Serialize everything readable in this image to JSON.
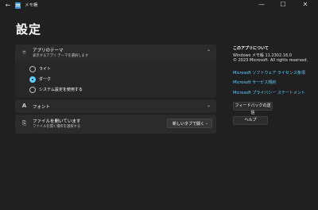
{
  "window": {
    "title": "メモ帳",
    "back_glyph": "←",
    "minimize_glyph": "—",
    "maximize_glyph": "☐",
    "close_glyph": "✕"
  },
  "page_title": "設定",
  "theme_card": {
    "title": "アプリのテーマ",
    "subtitle": "表示するアプリ テーマを選択します",
    "icon": "palette-icon",
    "options": [
      "ライト",
      "ダーク",
      "システム設定を使用する"
    ],
    "selected": "ダーク"
  },
  "font_card": {
    "title": "フォント",
    "icon": "font-icon"
  },
  "file_card": {
    "title": "ファイルを開いています",
    "subtitle": "ファイルを開く場所を選択する",
    "icon": "open-file-icon",
    "dropdown_value": "新しいタブで開く"
  },
  "about": {
    "heading": "このアプリについて",
    "version": "Windows メモ帳 11.2302.16.0",
    "copyright": "© 2023 Microsoft. All rights reserved.",
    "links": [
      "Microsoft ソフトウェア ライセンス条項",
      "Microsoft サービス規約",
      "Microsoft プライバシー ステートメント"
    ],
    "feedback_button": "フィードバックの送信",
    "help_button": "ヘルプ"
  },
  "colors": {
    "background": "#202020",
    "card": "#2b2b2b",
    "accent": "#60cdff"
  }
}
